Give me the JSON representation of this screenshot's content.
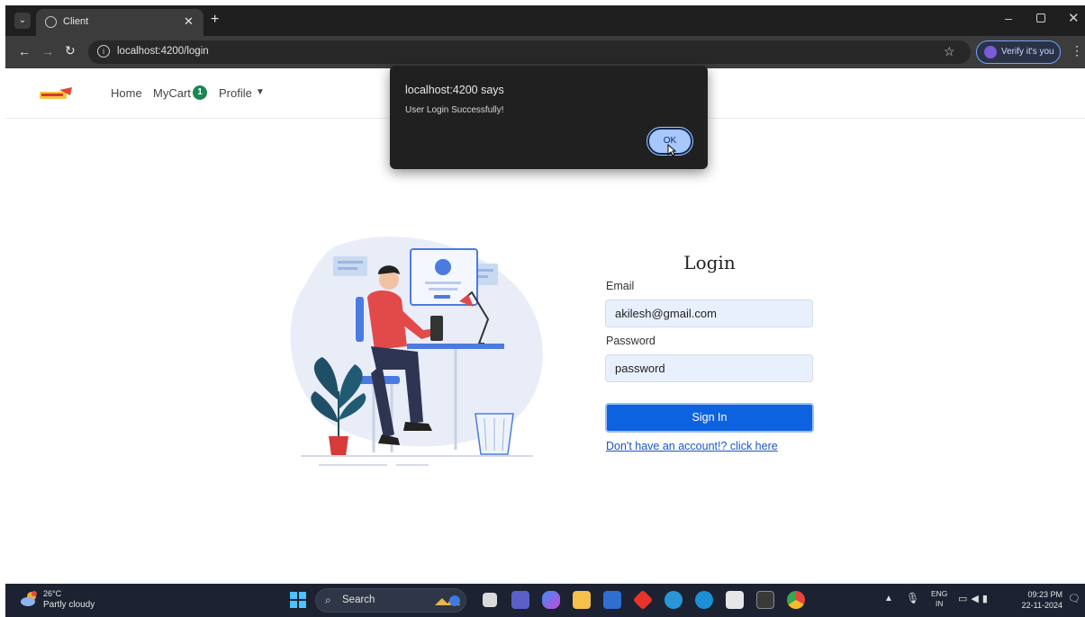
{
  "browser": {
    "tab_title": "Client",
    "url": "localhost:4200/login",
    "profile_button": "Verify it's you"
  },
  "navbar": {
    "home": "Home",
    "mycart": "MyCart",
    "cart_count": "1",
    "profile": "Profile"
  },
  "dialog": {
    "title": "localhost:4200 says",
    "message": "User Login Successfully!",
    "ok": "OK"
  },
  "login": {
    "title": "Login",
    "email_label": "Email",
    "email_value": "akilesh@gmail.com",
    "password_label": "Password",
    "password_value": "password",
    "signin": "Sign In",
    "register_link": "Don't have an account!? click here"
  },
  "taskbar": {
    "temperature": "26°C",
    "weather": "Partly cloudy",
    "search": "Search",
    "lang_top": "ENG",
    "lang_bottom": "IN",
    "time": "09:23 PM",
    "date": "22-11-2024"
  },
  "colors": {
    "primary_button": "#0d62e0",
    "cart_badge": "#198754",
    "dialog_bg": "#202020",
    "ok_button": "#a8c7fa"
  }
}
